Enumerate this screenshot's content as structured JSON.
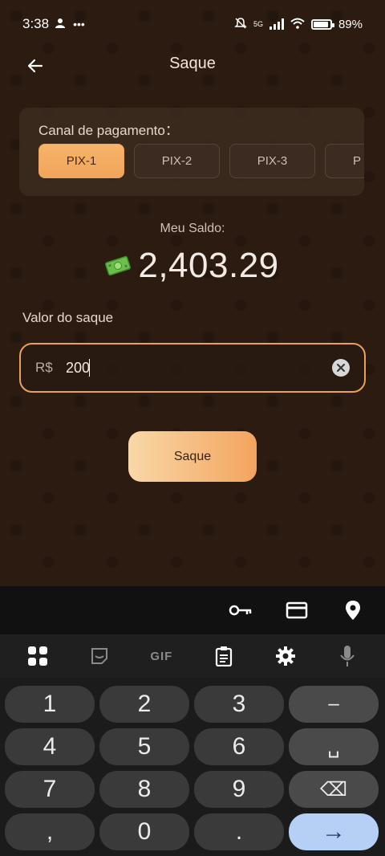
{
  "status_bar": {
    "time": "3:38",
    "battery": "89%",
    "network": "5G"
  },
  "header": {
    "title": "Saque"
  },
  "channel": {
    "label": "Canal de pagamento：",
    "options": [
      "PIX-1",
      "PIX-2",
      "PIX-3",
      "P"
    ],
    "selected": "PIX-1"
  },
  "balance": {
    "label": "Meu Saldo:",
    "value": "2,403.29"
  },
  "amount": {
    "label": "Valor do saque",
    "currency": "R$",
    "value": "200"
  },
  "submit_label": "Saque",
  "keyboard": {
    "toolbar": {
      "gif": "GIF"
    },
    "keys": [
      "1",
      "2",
      "3",
      "–",
      "4",
      "5",
      "6",
      "␣",
      "7",
      "8",
      "9",
      "⌫",
      ",",
      "0",
      ".",
      "→"
    ]
  },
  "colors": {
    "accent": "#f0a55a",
    "background": "#2b1b11",
    "enter_key": "#b6d0f5"
  }
}
